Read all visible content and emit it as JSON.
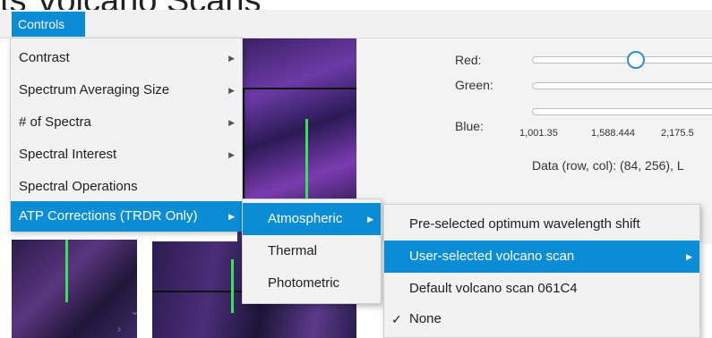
{
  "window_title": "ts Volcano Scans",
  "menubar": {
    "controls_label": "Controls"
  },
  "controls_menu": {
    "items": [
      {
        "label": "Contrast",
        "has_submenu": true
      },
      {
        "label": "Spectrum Averaging Size",
        "has_submenu": true
      },
      {
        "label": "# of Spectra",
        "has_submenu": true
      },
      {
        "label": "Spectral Interest",
        "has_submenu": true
      },
      {
        "label": "Spectral Operations",
        "has_submenu": false
      },
      {
        "label": "ATP Corrections (TRDR Only)",
        "has_submenu": true,
        "selected": true
      }
    ]
  },
  "atp_menu": {
    "items": [
      {
        "label": "Atmospheric",
        "has_submenu": true,
        "selected": true
      },
      {
        "label": "Thermal"
      },
      {
        "label": "Photometric"
      }
    ]
  },
  "atmospheric_menu": {
    "items": [
      {
        "label": "Pre-selected optimum wavelength shift"
      },
      {
        "label": "User-selected volcano scan",
        "has_submenu": true,
        "selected": true
      },
      {
        "label": "Default volcano scan 061C4"
      },
      {
        "label": "None",
        "checked": true
      }
    ]
  },
  "rgb_controls": {
    "red_label": "Red:",
    "green_label": "Green:",
    "blue_label": "Blue:",
    "red_level": 0.55,
    "ticks": [
      "1,001.35",
      "1,588.444",
      "2,175.5"
    ]
  },
  "data_readout": "Data (row, col): (84, 256), L",
  "icons": {
    "submenu_arrow": "right-triangle-icon",
    "checkmark": "check-icon",
    "scroll_down": "chevron-down-icon",
    "scroll_right": "chevron-right-icon"
  },
  "colors": {
    "accent": "#0a8dd4",
    "menu_bg": "#f2f2f2",
    "marker": "#38e25a"
  }
}
